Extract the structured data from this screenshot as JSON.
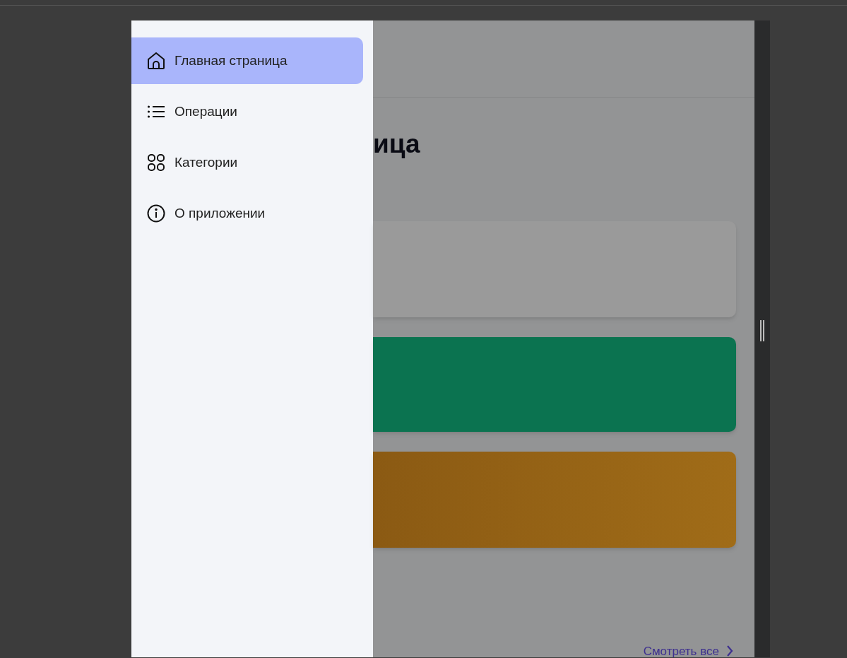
{
  "drawer": {
    "items": [
      {
        "label": "Главная страница",
        "selected": true
      },
      {
        "label": "Операции",
        "selected": false
      },
      {
        "label": "Категории",
        "selected": false
      },
      {
        "label": "О приложении",
        "selected": false
      }
    ]
  },
  "page": {
    "heading": "ица",
    "cards": [
      {
        "kind": "plain"
      },
      {
        "kind": "green"
      },
      {
        "kind": "orange"
      }
    ],
    "see_all_link": "Смотреть все"
  }
}
